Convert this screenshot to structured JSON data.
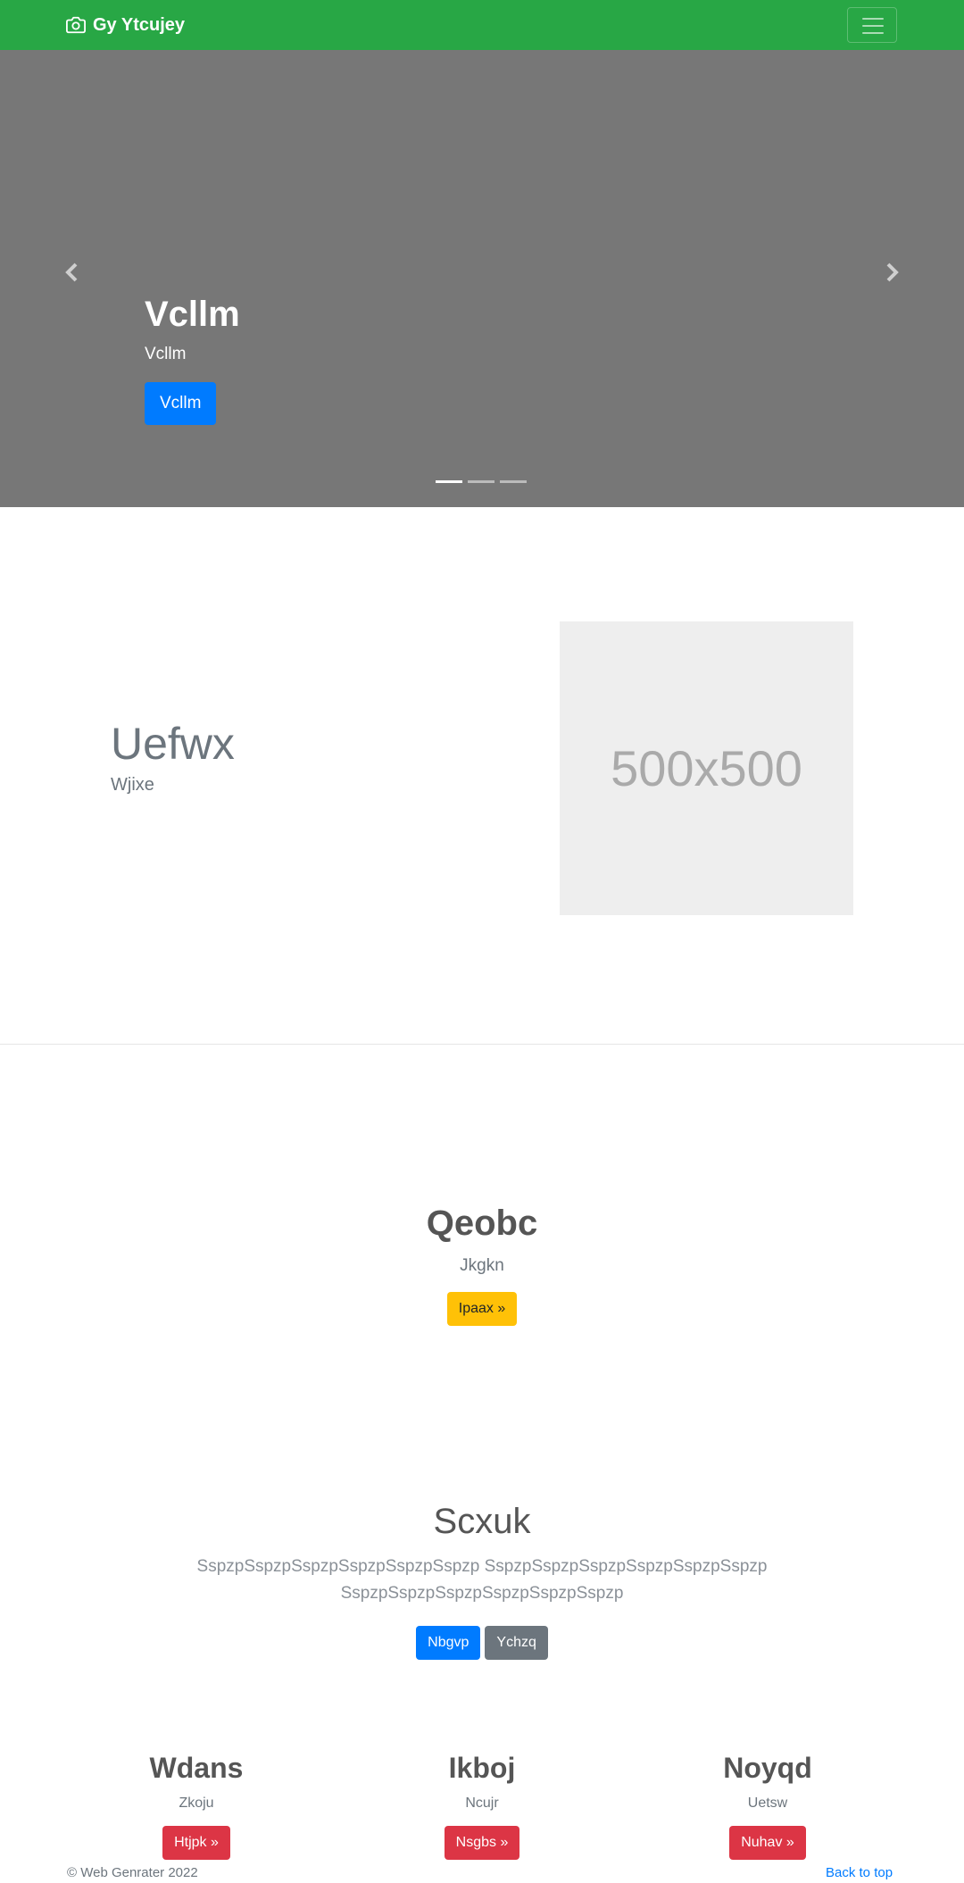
{
  "navbar": {
    "brand": "Gy Ytcujey",
    "brand_icon": "camera-icon",
    "toggler_icon": "hamburger-menu-icon",
    "background": "#28a745"
  },
  "carousel": {
    "title": "Vcllm",
    "subtitle": "Vcllm",
    "button_label": "Vcllm",
    "prev_icon": "chevron-left-icon",
    "next_icon": "chevron-right-icon",
    "slide_count": 3,
    "active_slide": 1,
    "background": "#777777"
  },
  "featurette": {
    "heading": "Uefwx",
    "subheading": "Wjixe",
    "image_label": "500x500"
  },
  "jumbotron": {
    "heading": "Qeobc",
    "text": "Jkgkn",
    "button_label": "Ipaax »"
  },
  "intro": {
    "heading": "Scxuk",
    "text": "SspzpSspzpSspzpSspzpSspzpSspzp SspzpSspzpSspzpSspzpSspzpSspzp SspzpSspzpSspzpSspzpSspzpSspzp",
    "primary_button": "Nbgvp",
    "secondary_button": "Ychzq"
  },
  "columns": [
    {
      "heading": "Wdans",
      "text": "Zkoju",
      "button_label": "Htjpk »"
    },
    {
      "heading": "Ikboj",
      "text": "Ncujr",
      "button_label": "Nsgbs »"
    },
    {
      "heading": "Noyqd",
      "text": "Uetsw",
      "button_label": "Nuhav »"
    }
  ],
  "footer": {
    "copyright": "© Web Genrater 2022",
    "back_to_top": "Back to top"
  }
}
